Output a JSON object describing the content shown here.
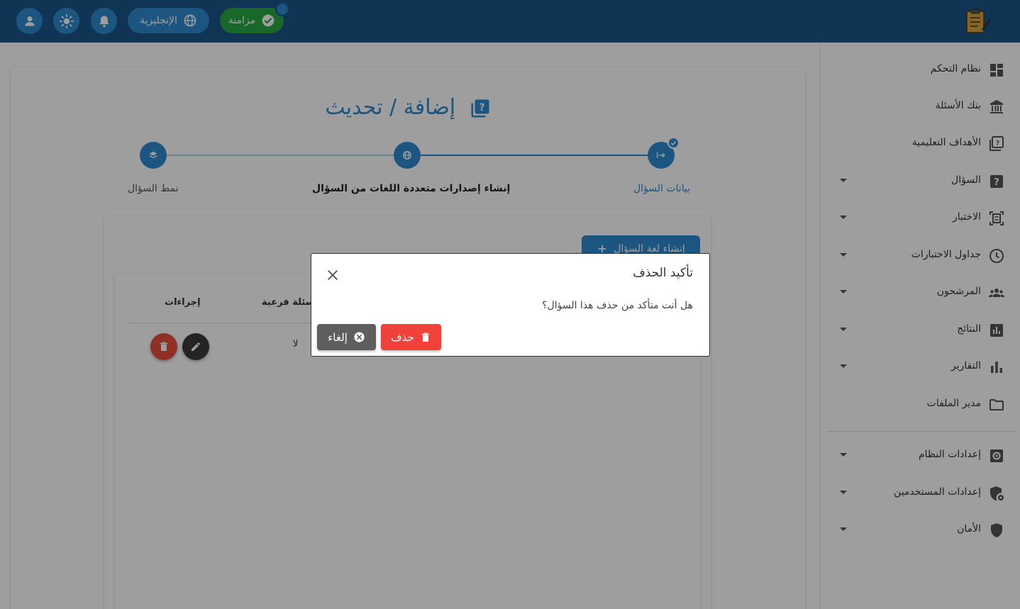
{
  "header": {
    "language_label": "الإنجليزية",
    "sync_label": "مزامنة"
  },
  "sidebar": {
    "items": [
      {
        "label": "نظام التحكم",
        "icon": "dashboard-icon",
        "expandable": false
      },
      {
        "label": "بنك الأسئلة",
        "icon": "bank-icon",
        "expandable": false
      },
      {
        "label": "الأهداف التعليمية",
        "icon": "objectives-icon",
        "expandable": false
      },
      {
        "label": "السؤال",
        "icon": "question-icon",
        "expandable": true
      },
      {
        "label": "الاختبار",
        "icon": "exam-icon",
        "expandable": true
      },
      {
        "label": "جداول الاختبارات",
        "icon": "clock-icon",
        "expandable": true
      },
      {
        "label": "المرشحون",
        "icon": "candidates-icon",
        "expandable": true
      },
      {
        "label": "النتائج",
        "icon": "results-icon",
        "expandable": true
      },
      {
        "label": "التقارير",
        "icon": "reports-icon",
        "expandable": true
      },
      {
        "label": "مدير الملفات",
        "icon": "folder-icon",
        "expandable": false
      },
      {
        "label": "إعدادات النظام",
        "icon": "settings-icon",
        "expandable": true
      },
      {
        "label": "إعدادات المستخدمين",
        "icon": "user-settings-icon",
        "expandable": true
      },
      {
        "label": "الأمان",
        "icon": "shield-icon",
        "expandable": true
      }
    ]
  },
  "page": {
    "title": "إضافة / تحديث"
  },
  "stepper": {
    "steps": [
      {
        "label": "بيانات السؤال",
        "state": "completed"
      },
      {
        "label": "إنشاء إصدارات متعددة اللغات من السؤال",
        "state": "active"
      },
      {
        "label": "نمط السؤال",
        "state": "pending"
      }
    ]
  },
  "content": {
    "create_button_label": "إنشاء لغة السؤال",
    "table": {
      "headers": [
        "أسئلة فرعية",
        "إجراءات"
      ],
      "rows": [
        {
          "sub_questions": "لا"
        }
      ]
    }
  },
  "modal": {
    "title": "تأكيد الحذف",
    "message": "هل أنت متأكد من حذف هذا السؤال؟",
    "delete_label": "حذف",
    "cancel_label": "إلغاء"
  },
  "colors": {
    "header": "#1a5486",
    "primary": "#2e8ccf",
    "sync": "#27a844",
    "danger": "#f0413a",
    "cancel": "#5e5e5e"
  }
}
